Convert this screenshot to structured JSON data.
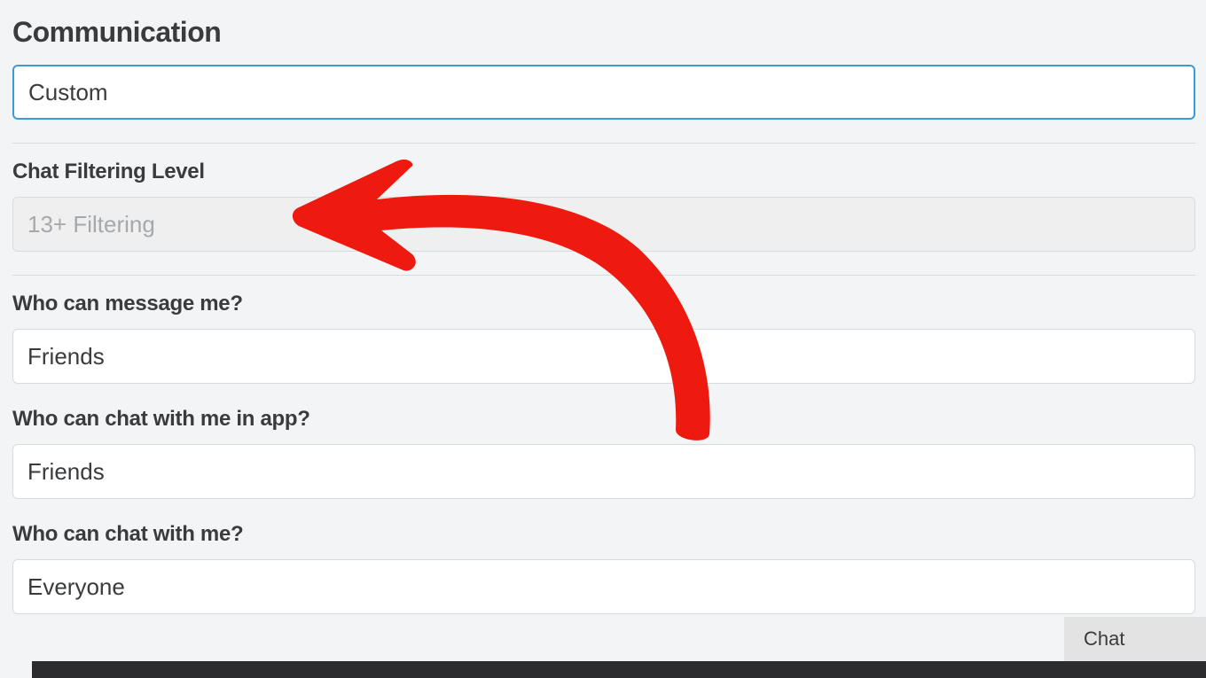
{
  "section": {
    "title": "Communication"
  },
  "fields": {
    "mode": {
      "value": "Custom"
    },
    "filtering": {
      "label": "Chat Filtering Level",
      "value": "13+ Filtering"
    },
    "message": {
      "label": "Who can message me?",
      "value": "Friends"
    },
    "chatInApp": {
      "label": "Who can chat with me in app?",
      "value": "Friends"
    },
    "chat": {
      "label": "Who can chat with me?",
      "value": "Everyone"
    }
  },
  "chatTab": {
    "label": "Chat"
  }
}
